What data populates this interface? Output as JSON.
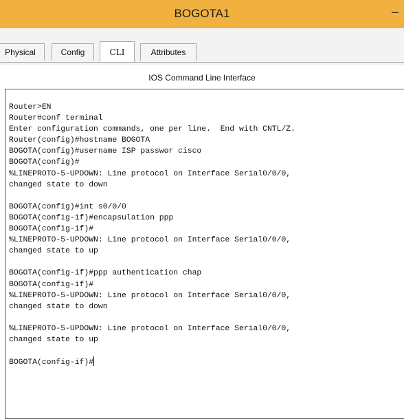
{
  "window": {
    "title": "BOGOTA1",
    "minimize_label": "–"
  },
  "tabs": [
    {
      "label": "Physical",
      "active": false
    },
    {
      "label": "Config",
      "active": false
    },
    {
      "label": "CLI",
      "active": true
    },
    {
      "label": "Attributes",
      "active": false
    }
  ],
  "cli": {
    "header": "IOS Command Line Interface",
    "lines": [
      "Router>EN",
      "Router#conf terminal",
      "Enter configuration commands, one per line.  End with CNTL/Z.",
      "Router(config)#hostname BOGOTA",
      "BOGOTA(config)#username ISP passwor cisco",
      "BOGOTA(config)#",
      "%LINEPROTO-5-UPDOWN: Line protocol on Interface Serial0/0/0,",
      "changed state to down",
      "",
      "BOGOTA(config)#int s0/0/0",
      "BOGOTA(config-if)#encapsulation ppp",
      "BOGOTA(config-if)#",
      "%LINEPROTO-5-UPDOWN: Line protocol on Interface Serial0/0/0,",
      "changed state to up",
      "",
      "BOGOTA(config-if)#ppp authentication chap",
      "BOGOTA(config-if)#",
      "%LINEPROTO-5-UPDOWN: Line protocol on Interface Serial0/0/0,",
      "changed state to down",
      "",
      "%LINEPROTO-5-UPDOWN: Line protocol on Interface Serial0/0/0,",
      "changed state to up",
      ""
    ],
    "prompt": "BOGOTA(config-if)#"
  }
}
